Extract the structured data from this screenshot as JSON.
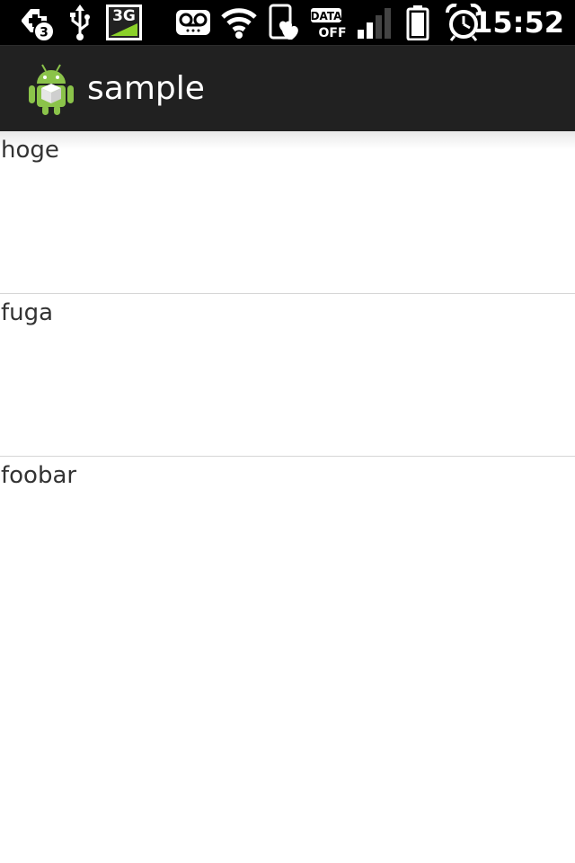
{
  "status_bar": {
    "notification_count": "3",
    "network_type": "3G",
    "data_label_top": "DATA",
    "data_label_bottom": "OFF",
    "time": "15:52",
    "icons": [
      "notification-plus-icon",
      "usb-icon",
      "3g-icon",
      "voicemail-icon",
      "wifi-icon",
      "phone-heart-icon",
      "data-off-icon",
      "signal-icon",
      "battery-icon",
      "alarm-icon"
    ]
  },
  "action_bar": {
    "icon": "android-app-icon",
    "title": "sample"
  },
  "list": {
    "items": [
      {
        "label": "hoge"
      },
      {
        "label": "fuga"
      },
      {
        "label": "foobar"
      }
    ]
  },
  "colors": {
    "status_bar_bg": "#000000",
    "action_bar_bg": "#212121",
    "android_green": "#8bc34a",
    "list_text": "#333333",
    "divider": "#d6d6d6"
  }
}
